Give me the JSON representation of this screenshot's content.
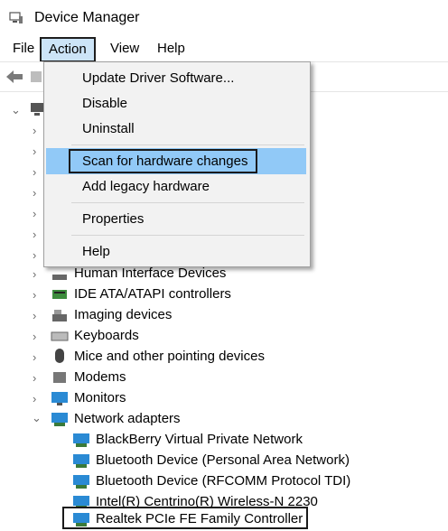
{
  "window": {
    "title": "Device Manager",
    "icon": "device-manager-icon"
  },
  "menubar": {
    "file": "File",
    "action": "Action",
    "view": "View",
    "help": "Help"
  },
  "toolbar": {
    "back_icon": "back-arrow-icon",
    "forward_icon": "forward-arrow-icon"
  },
  "action_menu": {
    "items": [
      "Update Driver Software...",
      "Disable",
      "Uninstall",
      "Scan for hardware changes",
      "Add legacy hardware",
      "Properties",
      "Help"
    ],
    "highlighted": "Scan for hardware changes"
  },
  "tree": {
    "categories": [
      "Human Interface Devices",
      "IDE ATA/ATAPI controllers",
      "Imaging devices",
      "Keyboards",
      "Mice and other pointing devices",
      "Modems",
      "Monitors",
      "Network adapters"
    ],
    "network_adapters": [
      "BlackBerry Virtual Private Network",
      "Bluetooth Device (Personal Area Network)",
      "Bluetooth Device (RFCOMM Protocol TDI)",
      "Intel(R) Centrino(R) Wireless-N 2230",
      "Realtek PCIe FE Family Controller"
    ],
    "selected": "Realtek PCIe FE Family Controller"
  },
  "colors": {
    "menu_highlight": "#91c9f7",
    "menu_bg": "#f2f2f2",
    "network_icon": "#2a8ad4"
  }
}
